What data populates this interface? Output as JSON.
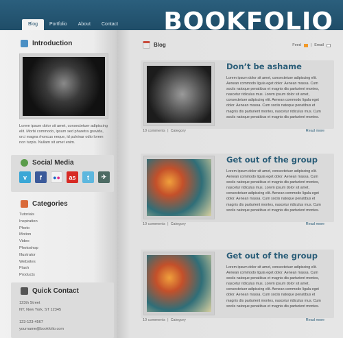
{
  "nav": {
    "items": [
      "Blog",
      "Portfolio",
      "About",
      "Contact"
    ],
    "active": "Blog"
  },
  "logo": "BOOKFOLIO",
  "sidebar": {
    "introduction": {
      "heading": "Introduction",
      "text": "Lorem ipsum dolor sit amet, consectetuer adipiscing elit. Morbi commodo, ipsum sed pharetra gravida, orci magna rhoncus neque, id pulvinar odio lorem non turpis. Nullam sit amet enim."
    },
    "social": {
      "heading": "Social Media",
      "icons": [
        "vimeo-icon",
        "facebook-icon",
        "flickr-icon",
        "lastfm-icon",
        "twitter-icon",
        "delicious-icon"
      ]
    },
    "categories": {
      "heading": "Categories",
      "items": [
        "Tutorials",
        "Inspiration",
        "Photo",
        "Motion",
        "Video",
        "Photoshop",
        "Illustrator",
        "Websites",
        "Flash",
        "Products"
      ]
    },
    "contact": {
      "heading": "Quick Contact",
      "street": "123th Street",
      "city": "NY, New York, ST 12345",
      "phone": "123-123-4567",
      "email": "yourname@bookfolio.com"
    }
  },
  "blog": {
    "heading": "Blog",
    "feed_label": "Feed",
    "email_label": "Email",
    "separator": "|",
    "posts": [
      {
        "title": "Don’t be ashame",
        "body": "Lorem ipsum dolor sit amet, consectetuer adipiscing elit. Aenean commodo ligula eget dolor. Aenean massa. Cum sociis natoque penatibus et magnis dis parturient montes, nascetur ridiculus mus. Lorem ipsum dolor sit amet, consectetuer adipiscing elit. Aenean commodo ligula eget dolor. Aenean massa. Cum sociis natoque penatibus et magnis dis parturient montes, nascetur ridiculus mus. Cum sociis natoque penatibus et magnis dis parturient montes.",
        "comments": "10 comments",
        "category": "Category",
        "more": "Read more"
      },
      {
        "title": "Get out of the group",
        "body": "Lorem ipsum dolor sit amet, consectetuer adipiscing elit. Aenean commodo ligula eget dolor. Aenean massa. Cum sociis natoque penatibus et magnis dis parturient montes, nascetur ridiculus mus. Lorem ipsum dolor sit amet, consectetuer adipiscing elit. Aenean commodo ligula eget dolor. Aenean massa. Cum sociis natoque penatibus et magnis dis parturient montes, nascetur ridiculus mus. Cum sociis natoque penatibus et magnis dis parturient montes.",
        "comments": "10 comments",
        "category": "Category",
        "more": "Read more"
      },
      {
        "title": "Get out of the group",
        "body": "Lorem ipsum dolor sit amet, consectetuer adipiscing elit. Aenean commodo ligula eget dolor. Aenean massa. Cum sociis natoque penatibus et magnis dis parturient montes, nascetur ridiculus mus. Lorem ipsum dolor sit amet, consectetuer adipiscing elit. Aenean commodo ligula eget dolor. Aenean massa. Cum sociis natoque penatibus et magnis dis parturient montes, nascetur ridiculus mus. Cum sociis natoque penatibus et magnis dis parturient montes.",
        "comments": "10 comments",
        "category": "Category",
        "more": "Read more"
      }
    ]
  },
  "colors": {
    "header": "#1f4d68",
    "accent": "#2a5d78",
    "page": "#e6e6e6"
  }
}
